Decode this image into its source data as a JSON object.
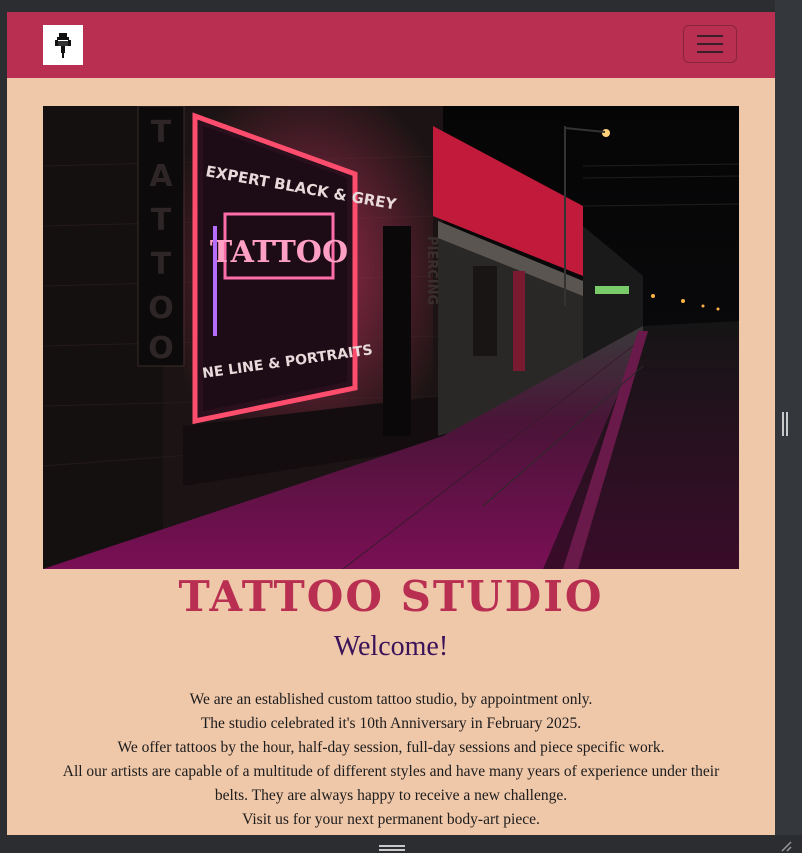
{
  "navbar": {
    "brand_icon": "tattoo-machine-icon",
    "toggler_icon": "hamburger-menu-icon",
    "accent_color": "#b92f52"
  },
  "hero": {
    "image_subject": "neon tattoo shop storefront at night",
    "neon_text_main": "TATTOO",
    "neon_text_top": "EXPERT BLACK & GREY",
    "neon_text_bottom": "FINE LINE & PORTRAITS",
    "vertical_sign_left": "TATTOO",
    "vertical_sign_right": "PIERCING"
  },
  "main": {
    "title": "TATTOO STUDIO",
    "welcome": "Welcome!",
    "lines": [
      "We are an established custom tattoo studio, by appointment only.",
      "The studio celebrated it's 10th Anniversary in February 2025.",
      "We offer tattoos by the hour, half-day session, full-day sessions and piece specific work.",
      "All our artists are capable of a multitude of different styles and have many years of experience under their belts. They are always happy to receive a new challenge.",
      "Visit us for your next permanent body-art piece."
    ]
  },
  "colors": {
    "page_background": "#efc7a9",
    "title": "#b92f52",
    "welcome": "#3b1359"
  }
}
